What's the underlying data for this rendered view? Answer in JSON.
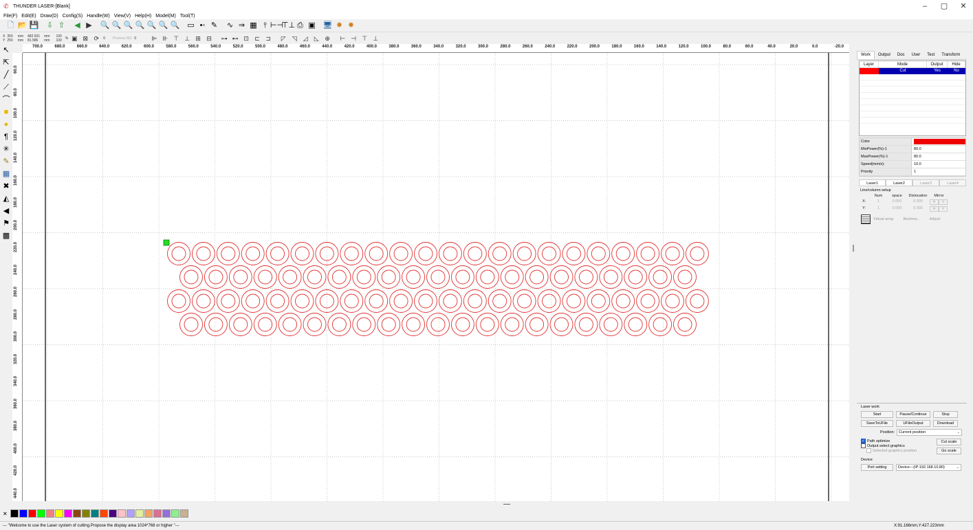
{
  "window": {
    "title": "THUNDER LASER-[Blank]",
    "min": "–",
    "max": "▢",
    "close": "✕"
  },
  "menu": [
    "File(F)",
    "Edit(E)",
    "Draw(D)",
    "Config(S)",
    "Handle(W)",
    "View(V)",
    "Help(H)",
    "Model(M)",
    "Tool(T)"
  ],
  "toolbar2": {
    "x_label": "X",
    "x_val": "350",
    "y_label": "Y",
    "y_val": "250",
    "mm1": "mm",
    "mm2": "mm",
    "w_val": "482.931",
    "h_val": "81.586",
    "mm3": "mm",
    "mm4": "mm",
    "pct1": "100",
    "pct2": "100",
    "pct_sym": "%",
    "rot_val": "0",
    "process_label": "Process NO:",
    "process_val": "0"
  },
  "ruler_h": [
    "700.0",
    "680.0",
    "660.0",
    "640.0",
    "620.0",
    "600.0",
    "580.0",
    "560.0",
    "540.0",
    "520.0",
    "500.0",
    "480.0",
    "460.0",
    "440.0",
    "420.0",
    "400.0",
    "380.0",
    "360.0",
    "340.0",
    "320.0",
    "300.0",
    "280.0",
    "260.0",
    "240.0",
    "220.0",
    "200.0",
    "180.0",
    "160.0",
    "140.0",
    "120.0",
    "100.0",
    "80.0",
    "60.0",
    "40.0",
    "20.0",
    "0.0",
    "-20.0"
  ],
  "ruler_v": [
    "60.0",
    "80.0",
    "100.0",
    "120.0",
    "140.0",
    "160.0",
    "180.0",
    "200.0",
    "220.0",
    "240.0",
    "260.0",
    "280.0",
    "300.0",
    "320.0",
    "340.0",
    "360.0",
    "380.0",
    "400.0",
    "420.0",
    "440.0"
  ],
  "right_panel": {
    "tabs": [
      "Work",
      "Output",
      "Doc",
      "User",
      "Test",
      "Transform"
    ],
    "layer_headers": [
      "Layer",
      "Mode",
      "Output",
      "Hide"
    ],
    "layer_row": {
      "mode": "Cut",
      "output": "Yes",
      "hide": "No",
      "color": "#ff0000"
    },
    "props": [
      {
        "k": "Color",
        "v": ""
      },
      {
        "k": "MinPower(%)-1",
        "v": "80.0"
      },
      {
        "k": "MaxPower(%)-1",
        "v": "80.0"
      },
      {
        "k": "Speed(mm/s):",
        "v": "10.0"
      },
      {
        "k": "Priority",
        "v": "1"
      }
    ],
    "laser_tabs": [
      "Laser1",
      "Laser2",
      "Laser3",
      "Laser4"
    ],
    "lcs_title": "Line/column setup",
    "lcs_headers": [
      "Num",
      "space",
      "Dislocation",
      "Mirror"
    ],
    "lcs_x": {
      "lab": "X:",
      "num": "1",
      "space": "0.000",
      "disl": "0.000",
      "m1": "H",
      "m2": "V"
    },
    "lcs_y": {
      "lab": "Y:",
      "num": "1",
      "space": "0.000",
      "disl": "0.000",
      "m1": "H",
      "m2": "V"
    },
    "va": {
      "virtual": "Virtual array",
      "bestrew": "Bestrew...",
      "adjust": "Adjust"
    }
  },
  "laser_work": {
    "title": "Laser work",
    "start": "Start",
    "pause": "Pause/Continue",
    "stop": "Stop",
    "save": "SaveToUFile",
    "ufile": "UFileOutput",
    "download": "Download",
    "position_label": "Position:",
    "position_val": "Current position",
    "path_opt": "Path optimize",
    "output_sel": "Output select graphics",
    "sel_pos": "Selected graphics position",
    "cut_scale": "Cut scale",
    "go_scale": "Go scale",
    "device_title": "Device",
    "port": "Port setting",
    "device_val": "Device---(IP:192.168.10.80)"
  },
  "palette": [
    "#000000",
    "#0000ff",
    "#ff0000",
    "#00ff00",
    "#f08080",
    "#ffff00",
    "#ff00ff",
    "#8b4513",
    "#808000",
    "#008080",
    "#ff4500",
    "#4b0082",
    "#ffc0cb",
    "#b0a0ff",
    "#e0f0a0",
    "#f4a460",
    "#db7093",
    "#9370db",
    "#90ee90",
    "#c8b090"
  ],
  "palette_x": "✕",
  "status": {
    "msg": "--- \"Welcome to use the Laser system of cutting.Propose the display area 1024*768 or higher \"---",
    "coords": "X:91.166mm,Y:427.223mm"
  }
}
